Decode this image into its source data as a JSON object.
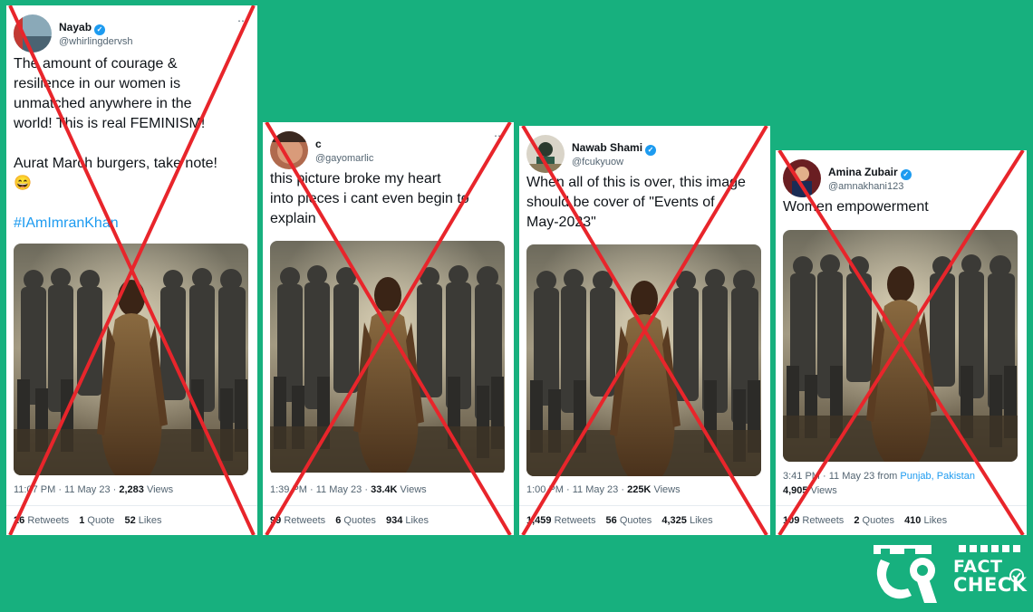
{
  "tweets": [
    {
      "name": "Nayab",
      "handle": "@whirlingdervsh",
      "lines": [
        "The amount of courage &",
        "resilience in our women is",
        "unmatched anywhere in the",
        "world! This is real FEMINISM!",
        "",
        "Aurat March burgers, take note!",
        "😄",
        "",
        "#IAmImranKhan"
      ],
      "meta": "11:07 PM · 11 May 23 · ",
      "views": "2,283",
      "views_label": "Views",
      "retweets": "26",
      "retweets_label": "Retweets",
      "quotes": "1",
      "quotes_label": "Quote",
      "likes": "52",
      "likes_label": "Likes"
    },
    {
      "name": "c",
      "handle": "@gayomarlic",
      "lines": [
        "this picture broke my heart",
        "into pieces i cant even begin to",
        "explain"
      ],
      "meta": "1:39 PM · 11 May 23 · ",
      "views": "33.4K",
      "views_label": "Views",
      "retweets": "99",
      "retweets_label": "Retweets",
      "quotes": "6",
      "quotes_label": "Quotes",
      "likes": "934",
      "likes_label": "Likes"
    },
    {
      "name": "Nawab Shami",
      "handle": "@fcukyuow",
      "lines": [
        "When all of this is over, this image",
        "should be cover of \"Events of",
        "May-2023\""
      ],
      "meta": "1:00 PM · 11 May 23 · ",
      "views": "225K",
      "views_label": "Views",
      "retweets": "1,459",
      "retweets_label": "Retweets",
      "quotes": "56",
      "quotes_label": "Quotes",
      "likes": "4,325",
      "likes_label": "Likes"
    },
    {
      "name": "Amina Zubair",
      "handle": "@amnakhani123",
      "lines": [
        "Women empowerment"
      ],
      "meta": "3:41 PM · 11 May 23 from ",
      "location": "Punjab, Pakistan",
      "views": "4,905",
      "views_label": "Views",
      "retweets": "109",
      "retweets_label": "Retweets",
      "quotes": "2",
      "quotes_label": "Quotes",
      "likes": "410",
      "likes_label": "Likes"
    }
  ],
  "logo": {
    "line1": "FACT",
    "line2": "CHECK",
    "mark": "۹"
  },
  "colors": {
    "background": "#17b07e",
    "cross": "#e8252b",
    "link": "#1d9bf0"
  },
  "icons": [
    "verified-badge-icon",
    "more-options-icon",
    "check-circle-icon"
  ]
}
